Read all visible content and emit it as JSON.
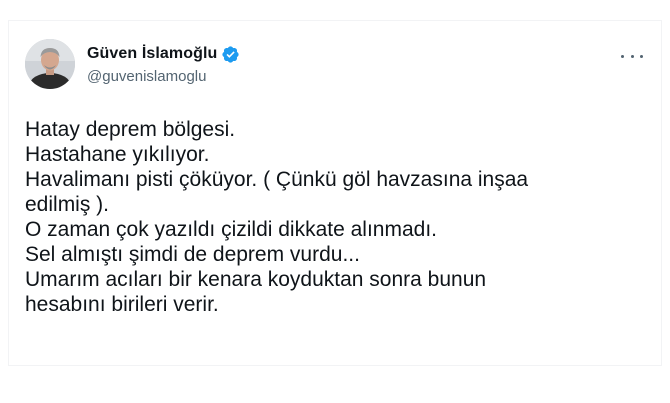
{
  "author": {
    "display_name": "Güven İslamoğlu",
    "handle": "@guvenislamoglu",
    "verified": true,
    "verified_icon": "verified-badge-icon",
    "accent_color": "#1d9bf0"
  },
  "menu": {
    "icon": "more-options-icon"
  },
  "tweet": {
    "lines": [
      "Hatay deprem bölgesi.",
      "Hastahane yıkılıyor.",
      "Havalimanı pisti çöküyor. ( Çünkü göl havzasına inşaa",
      "edilmiş ).",
      "O zaman çok yazıldı çizildi dikkate alınmadı.",
      "Sel almıştı şimdi de deprem vurdu...",
      "Umarım acıları bir kenara koyduktan sonra bunun",
      "hesabını birileri verir."
    ]
  }
}
